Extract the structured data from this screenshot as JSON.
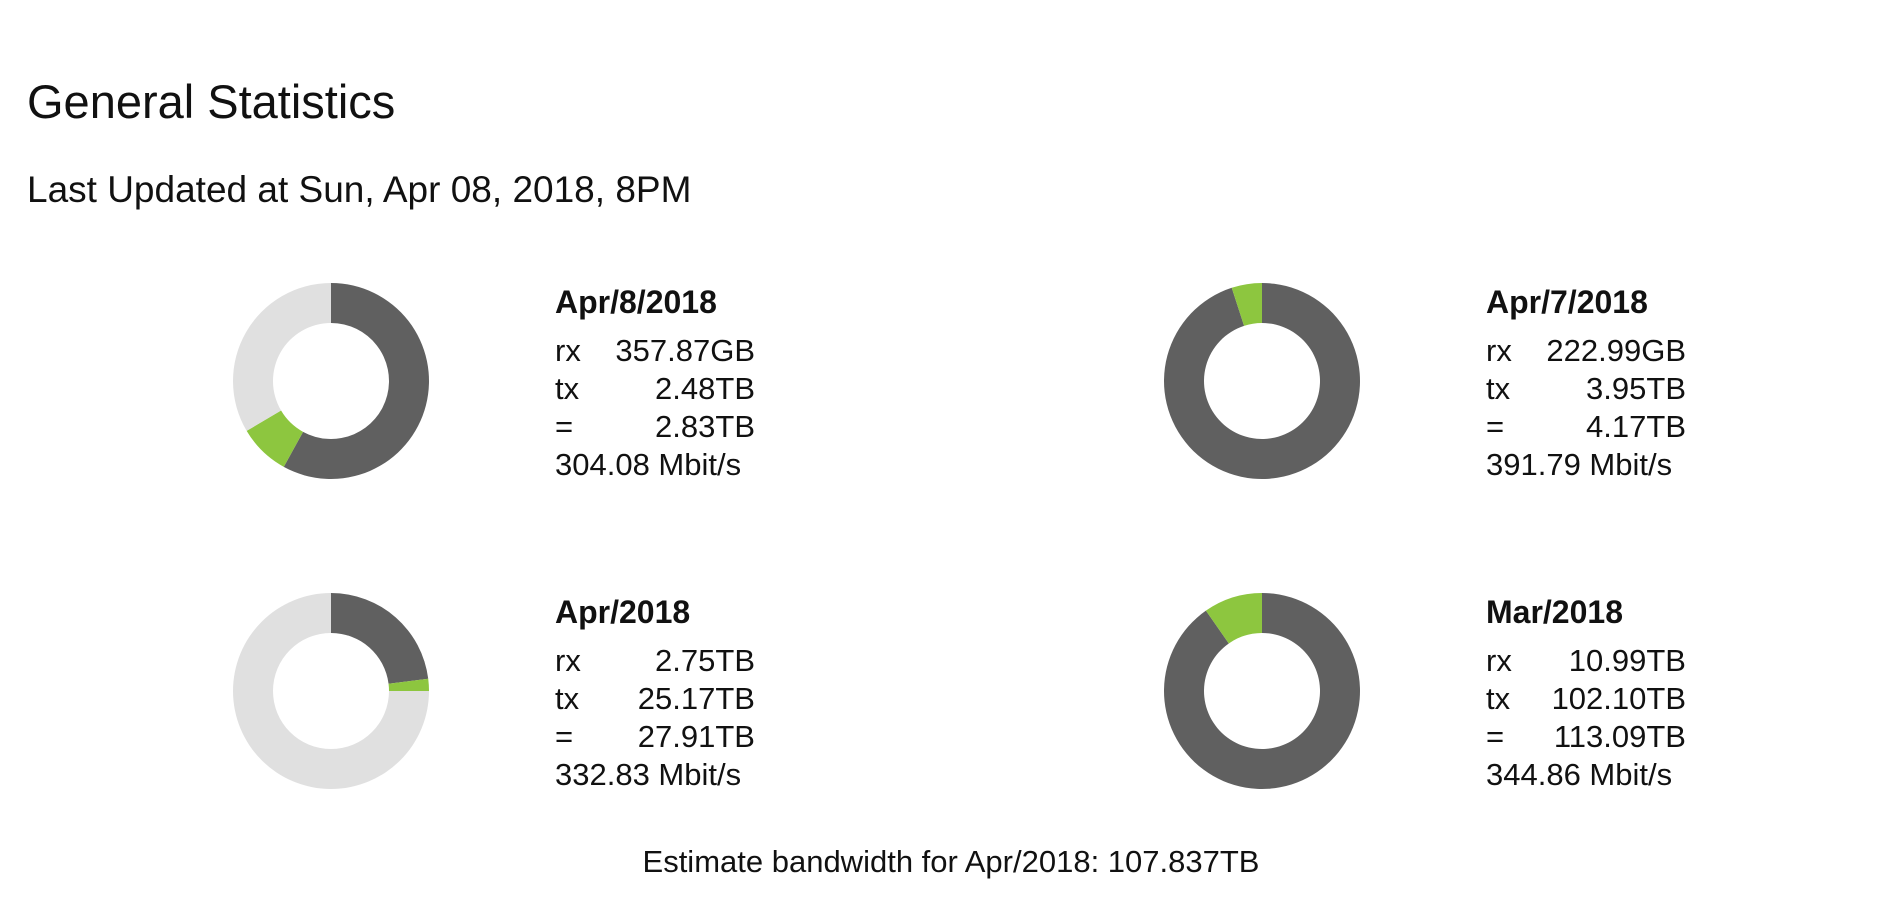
{
  "page": {
    "title": "General Statistics",
    "last_updated": "Last Updated at Sun, Apr 08, 2018, 8PM",
    "footer": "Estimate bandwidth for Apr/2018: 107.837TB"
  },
  "colors": {
    "tx": "#606060",
    "rx": "#8dc63f",
    "remaining": "#e0e0e0"
  },
  "labels": {
    "rx": "rx",
    "tx": "tx",
    "total": "="
  },
  "blocks": [
    {
      "period": "Apr/8/2018",
      "rx": "357.87GB",
      "tx": "2.48TB",
      "total": "2.83TB",
      "rate": "304.08 Mbit/s",
      "tx_fraction": 0.58,
      "rx_fraction": 0.085
    },
    {
      "period": "Apr/7/2018",
      "rx": "222.99GB",
      "tx": "3.95TB",
      "total": "4.17TB",
      "rate": "391.79 Mbit/s",
      "tx_fraction": 0.95,
      "rx_fraction": 0.05
    },
    {
      "period": "Apr/2018",
      "rx": "2.75TB",
      "tx": "25.17TB",
      "total": "27.91TB",
      "rate": "332.83 Mbit/s",
      "tx_fraction": 0.23,
      "rx_fraction": 0.02
    },
    {
      "period": "Mar/2018",
      "rx": "10.99TB",
      "tx": "102.10TB",
      "total": "113.09TB",
      "rate": "344.86 Mbit/s",
      "tx_fraction": 0.903,
      "rx_fraction": 0.097
    }
  ]
}
